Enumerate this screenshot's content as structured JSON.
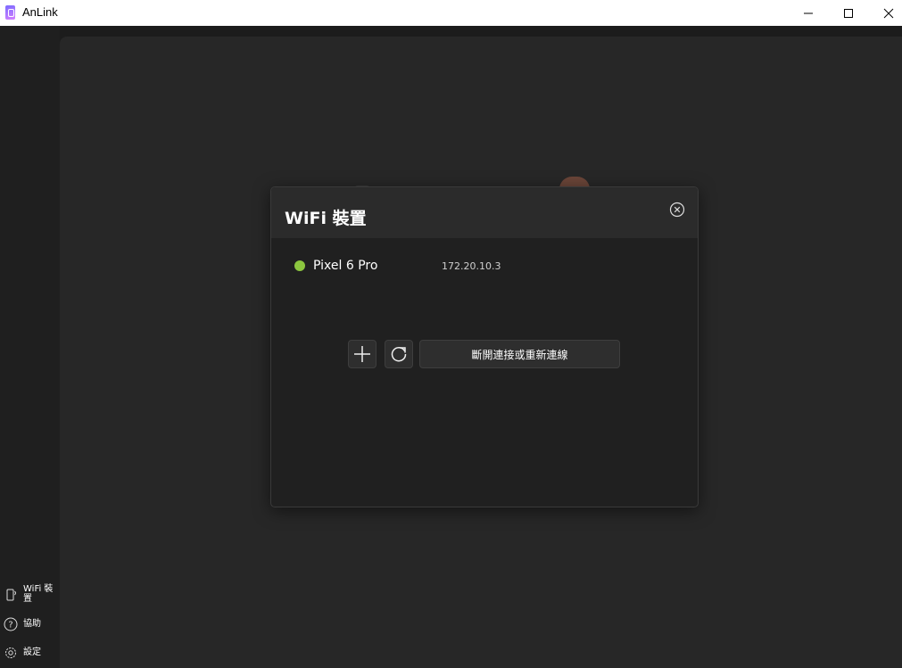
{
  "window": {
    "title": "AnLink"
  },
  "sidebar": {
    "items": [
      {
        "label": "WiFi 裝置",
        "icon": "phone-icon"
      },
      {
        "label": "協助",
        "icon": "help-icon"
      },
      {
        "label": "設定",
        "icon": "gear-icon"
      }
    ]
  },
  "dialog": {
    "title": "WiFi 裝置",
    "devices": [
      {
        "name": "Pixel 6 Pro",
        "ip": "172.20.10.3",
        "status_color": "#8cc63f"
      }
    ],
    "reconnect_label": "斷開連接或重新連線"
  },
  "colors": {
    "background": "#272727",
    "sidebar": "#1f1f1f",
    "dialog": "#202020",
    "status_online": "#8cc63f"
  }
}
